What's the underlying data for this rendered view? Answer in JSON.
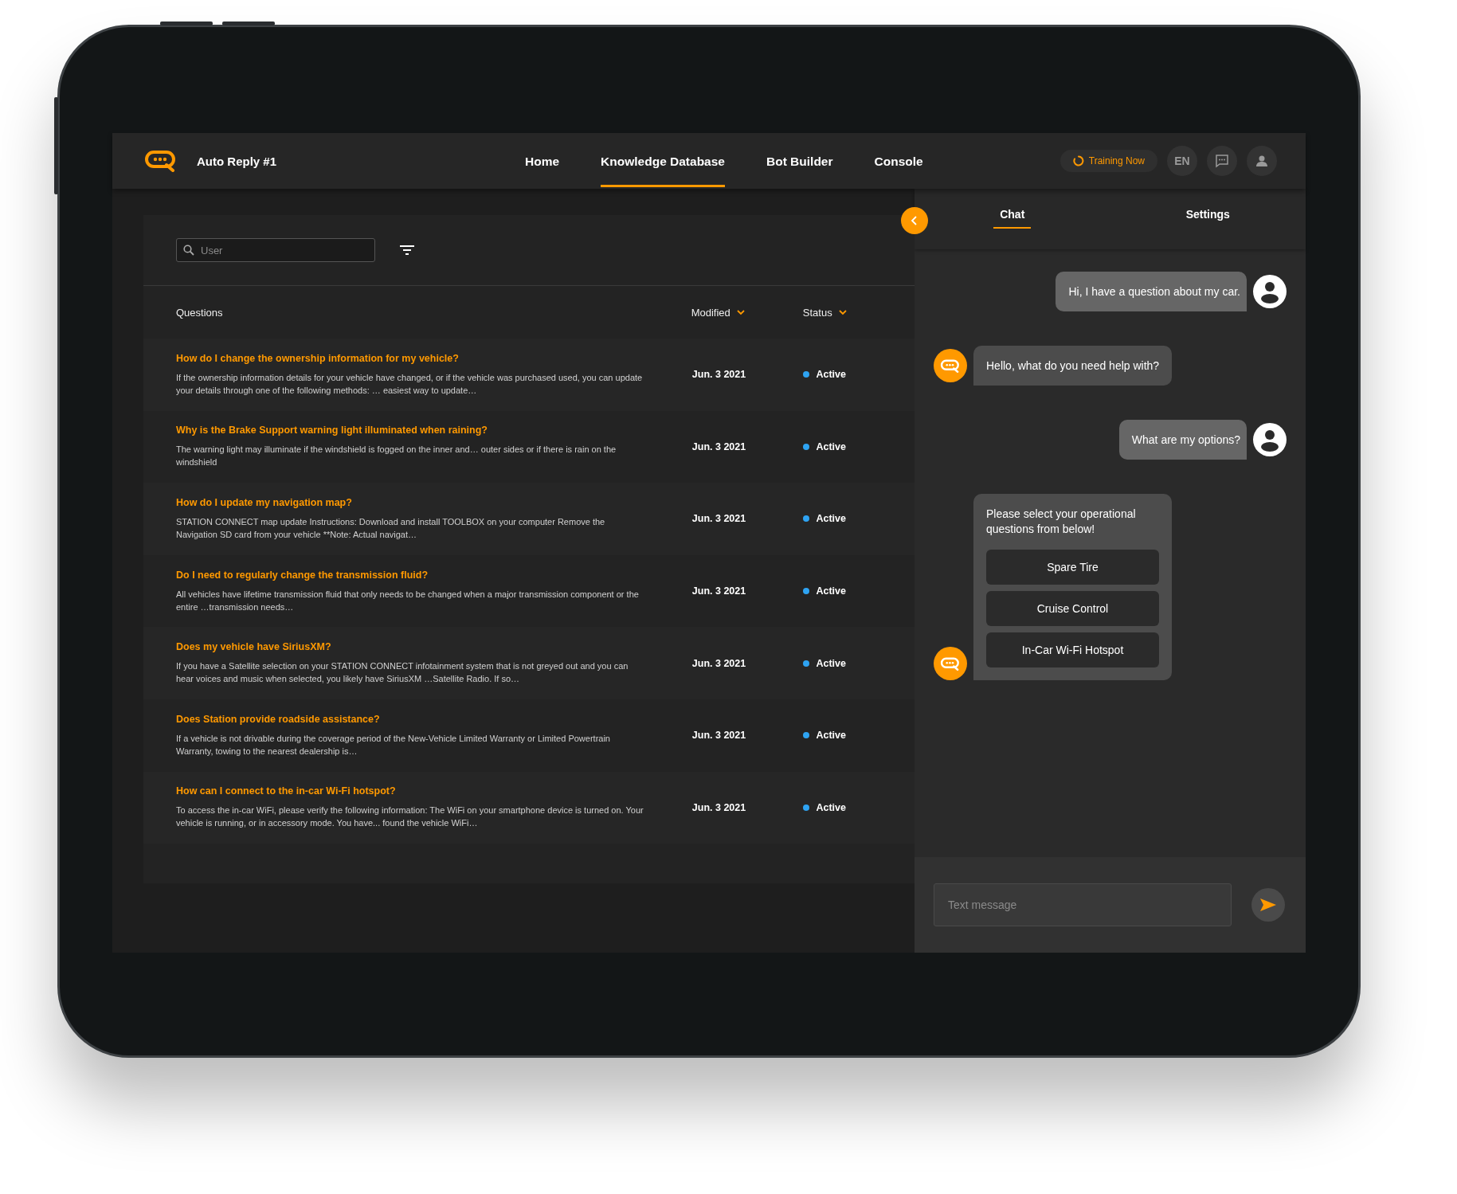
{
  "app": {
    "title": "Auto Reply #1"
  },
  "nav": [
    {
      "label": "Home",
      "selected": false
    },
    {
      "label": "Knowledge Database",
      "selected": true
    },
    {
      "label": "Bot Builder",
      "selected": false
    },
    {
      "label": "Console",
      "selected": false
    }
  ],
  "training": {
    "label": "Training Now"
  },
  "language": {
    "label": "EN"
  },
  "search": {
    "placeholder": "User"
  },
  "table": {
    "columns": [
      {
        "label": "Questions",
        "sortable": false
      },
      {
        "label": "Modified",
        "sortable": true
      },
      {
        "label": "Status",
        "sortable": true
      }
    ],
    "rows": [
      {
        "question": "How do I change the ownership information for my vehicle?",
        "answer": "If the ownership information details for your vehicle have changed, or if the vehicle was purchased used, you can update your details through one of the following methods: … easiest way to update…",
        "modified": "Jun. 3 2021",
        "status": "Active",
        "active": true
      },
      {
        "question": "Why is the Brake Support warning light illuminated when raining?",
        "answer": "The warning light may illuminate if the windshield is fogged on the inner and… outer sides or if there is rain on the windshield",
        "modified": "Jun. 3 2021",
        "status": "Active",
        "active": true
      },
      {
        "question": "How do I update my navigation map?",
        "answer": "STATION CONNECT map update Instructions: Download and install TOOLBOX on your computer Remove the Navigation SD card from your vehicle **Note: Actual navigat…",
        "modified": "Jun. 3 2021",
        "status": "Active",
        "active": true
      },
      {
        "question": "Do I need to regularly change the transmission fluid?",
        "answer": "All vehicles have lifetime transmission fluid that only needs to be changed when a major transmission component or the entire …transmission needs…",
        "modified": "Jun. 3 2021",
        "status": "Active",
        "active": true
      },
      {
        "question": "Does my vehicle have SiriusXM?",
        "answer": "If you have a Satellite selection on your STATION CONNECT infotainment system that is not greyed out and you can hear voices and music when selected, you likely have SiriusXM …Satellite Radio. If so…",
        "modified": "Jun. 3 2021",
        "status": "Active",
        "active": true
      },
      {
        "question": "Does Station provide roadside assistance?",
        "answer": "If a vehicle is not drivable during the coverage period of the New-Vehicle Limited Warranty or Limited Powertrain Warranty, towing to the nearest dealership is…",
        "modified": "Jun. 3 2021",
        "status": "Active",
        "active": true
      },
      {
        "question": "How can I connect to the in-car Wi-Fi hotspot?",
        "answer": "To access the in-car WiFi, please verify the following information: The WiFi on your smartphone device is turned on. Your vehicle is running, or in accessory mode. You have... found the vehicle WiFi…",
        "modified": "Jun. 3 2021",
        "status": "Active",
        "active": true
      }
    ]
  },
  "chat": {
    "tabs": [
      {
        "label": "Chat",
        "selected": true
      },
      {
        "label": "Settings",
        "selected": false
      }
    ],
    "messages": [
      {
        "kind": "user",
        "text": "Hi, I have a question about my car."
      },
      {
        "kind": "bot",
        "text": "Hello, what do you need help with?"
      },
      {
        "kind": "user",
        "text": "What are my options?"
      },
      {
        "kind": "bot",
        "text": "Please select your operational questions from below!",
        "options": [
          "Spare Tire",
          "Cruise Control",
          "In-Car Wi-Fi Hotspot"
        ]
      }
    ],
    "input": {
      "placeholder": "Text message"
    }
  }
}
